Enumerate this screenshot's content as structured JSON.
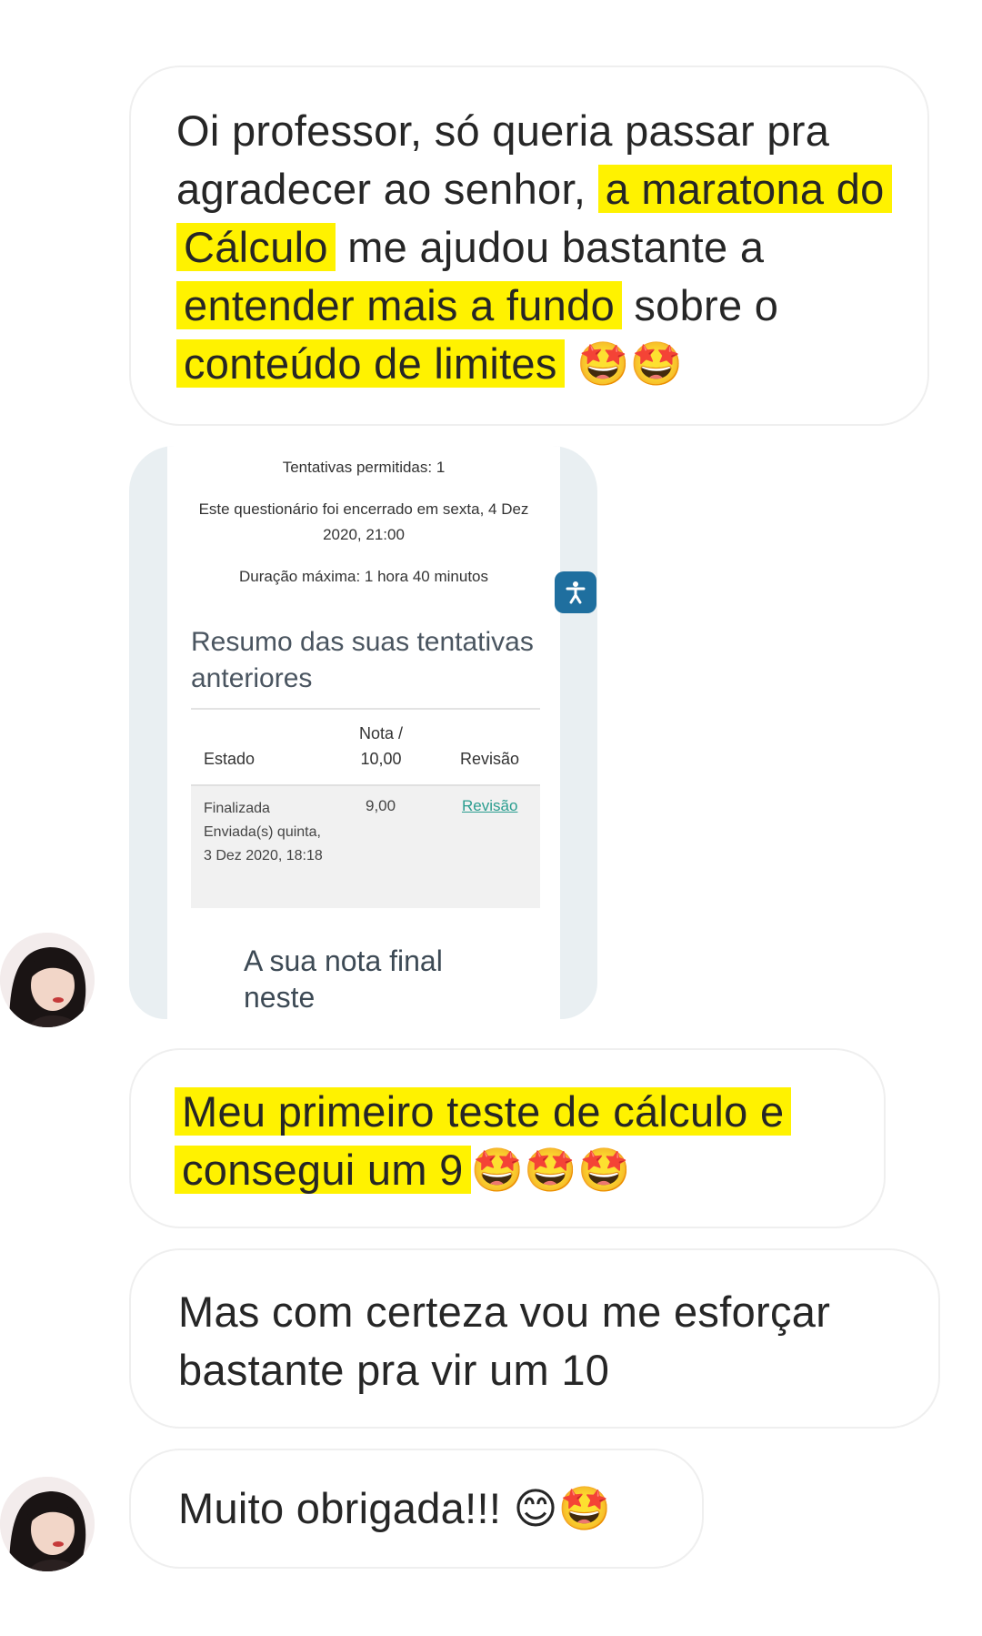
{
  "messages": [
    {
      "segments": [
        {
          "text": "Oi professor, só queria passar pra agradecer ao senhor, ",
          "hl": false
        },
        {
          "text": "a maratona do Cálculo",
          "hl": true
        },
        {
          "text": " me ajudou bastante a ",
          "hl": false
        },
        {
          "text": "entender mais a fundo",
          "hl": true
        },
        {
          "text": " sobre o ",
          "hl": false
        },
        {
          "text": "conteúdo de limites",
          "hl": true
        },
        {
          "text": " 🤩🤩",
          "hl": false
        }
      ]
    },
    {
      "segments": [
        {
          "text": "Meu primeiro teste de cálculo e consegui um 9",
          "hl": true
        },
        {
          "text": "🤩🤩🤩",
          "hl": false
        }
      ]
    },
    {
      "segments": [
        {
          "text": "Mas com certeza vou me esforçar bastante pra vir um 10",
          "hl": false
        }
      ]
    },
    {
      "segments": [
        {
          "text": "Muito obrigada!!! 😊🤩",
          "hl": false
        }
      ]
    }
  ],
  "screenshot": {
    "allowed": "Tentativas permitidas: 1",
    "closed": "Este questionário foi encerrado em sexta, 4 Dez 2020, 21:00",
    "duration": "Duração máxima: 1 hora 40 minutos",
    "summary_title": "Resumo das suas tentativas anteriores",
    "col_state": "Estado",
    "col_grade": "Nota / 10,00",
    "col_review": "Revisão",
    "row_state": "Finalizada Enviada(s) quinta, 3 Dez 2020, 18:18",
    "row_grade": "9,00",
    "row_review": "Revisão",
    "final_text": "A sua nota final neste"
  },
  "icons": {
    "accessibility": "accessibility-icon",
    "avatar": "user-avatar"
  },
  "colors": {
    "highlight": "#fff200",
    "bubble_border": "#efefef",
    "link": "#2a9d8f",
    "accessibility_button": "#1f6f9f"
  }
}
